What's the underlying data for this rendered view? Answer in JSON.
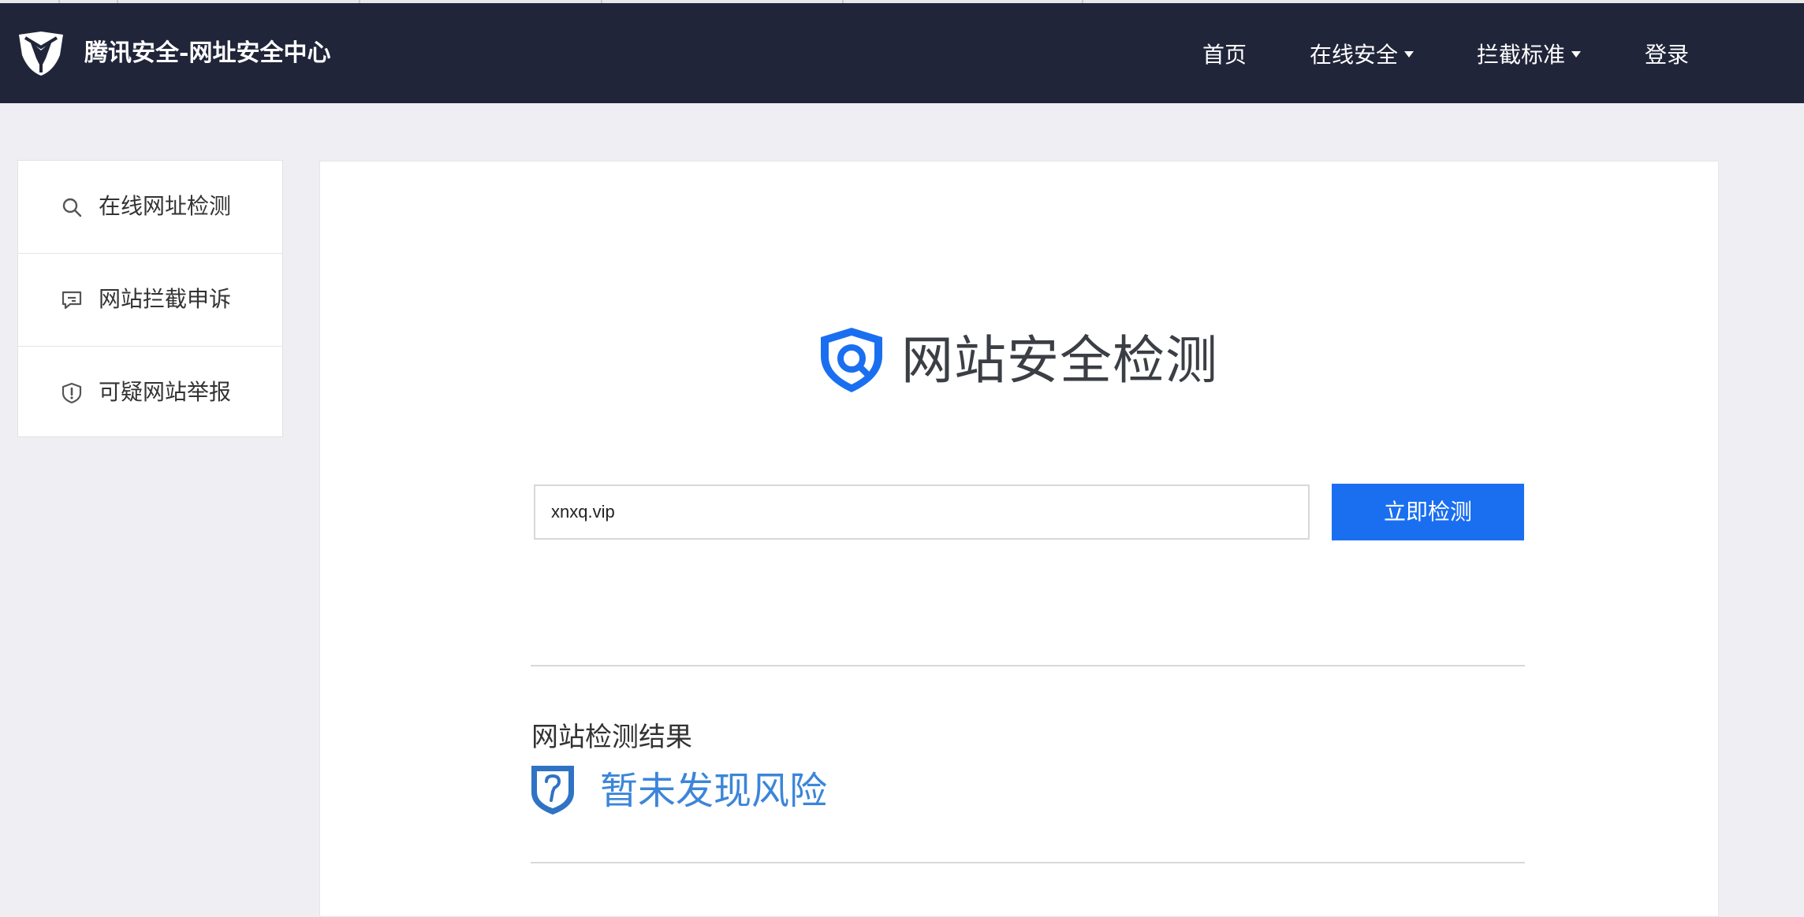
{
  "header": {
    "site_title": "腾讯安全-网址安全中心",
    "nav": [
      {
        "label": "首页",
        "has_dropdown": false
      },
      {
        "label": "在线安全",
        "has_dropdown": true
      },
      {
        "label": "拦截标准",
        "has_dropdown": true
      },
      {
        "label": "登录",
        "has_dropdown": false
      }
    ]
  },
  "sidebar": {
    "items": [
      {
        "label": "在线网址检测",
        "icon": "search-icon"
      },
      {
        "label": "网站拦截申诉",
        "icon": "message-icon"
      },
      {
        "label": "可疑网站举报",
        "icon": "shield-alert-icon"
      }
    ]
  },
  "main": {
    "brand_title": "网站安全检测",
    "url_input": {
      "value": "xnxq.vip",
      "placeholder": ""
    },
    "check_button_label": "立即检测",
    "result_heading": "网站检测结果",
    "result_text": "暂未发现风险",
    "result_icon": "shield-question-icon"
  },
  "colors": {
    "header_bg": "#21253a",
    "page_bg": "#efeff3",
    "accent_button": "#1a6ff0",
    "result_blue": "#3b86d9"
  }
}
